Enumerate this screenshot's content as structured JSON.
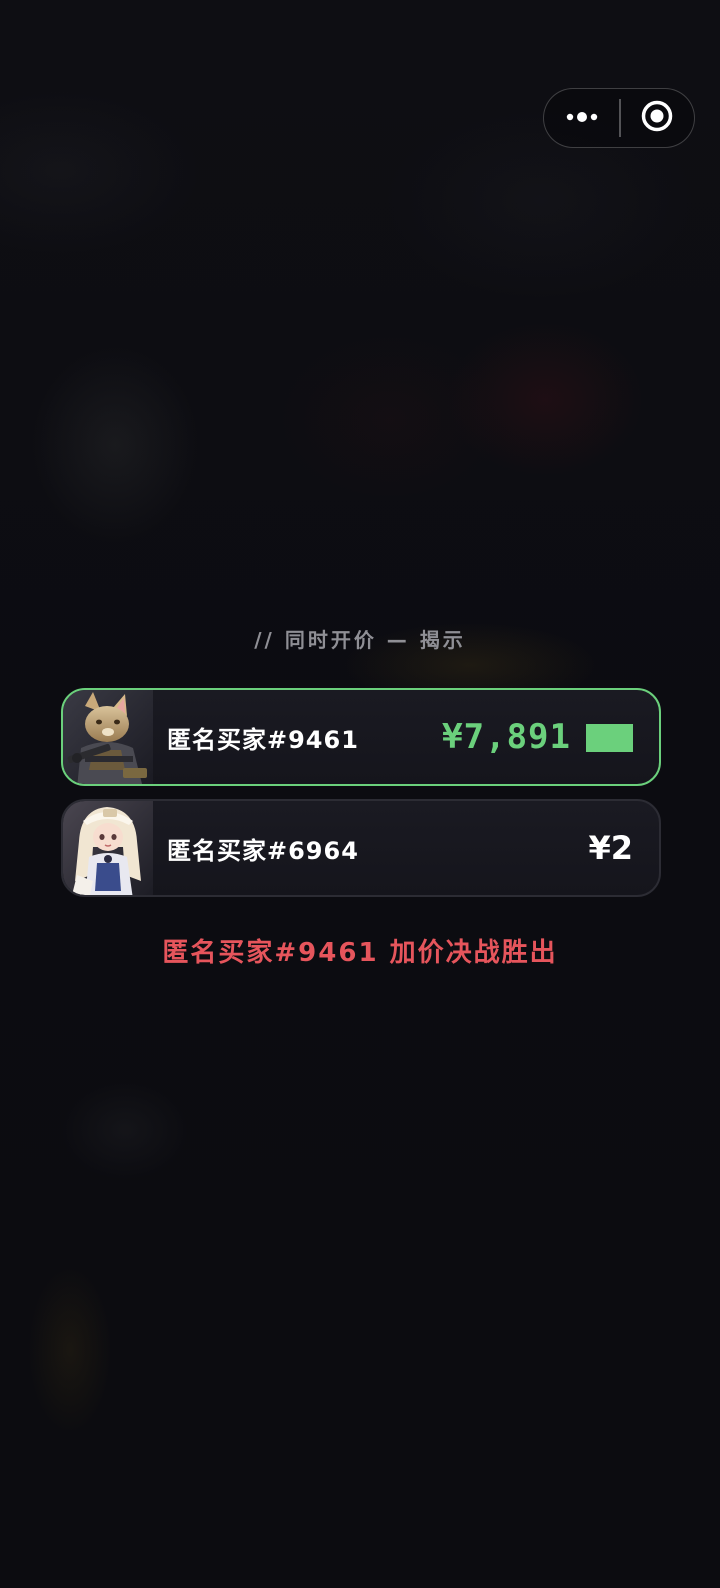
{
  "capsule": {
    "more_icon": "more-dots-icon",
    "close_icon": "target-circle-icon"
  },
  "reveal": {
    "subtitle": "// 同时开价 — 揭示"
  },
  "bids": [
    {
      "name": "匿名买家#9461",
      "price": "¥7,891",
      "winner": true,
      "accent": "#6bd07c"
    },
    {
      "name": "匿名买家#6964",
      "price": "¥2",
      "winner": false
    }
  ],
  "result": {
    "text": "匿名买家#9461 加价决战胜出",
    "color": "#e6555c"
  }
}
